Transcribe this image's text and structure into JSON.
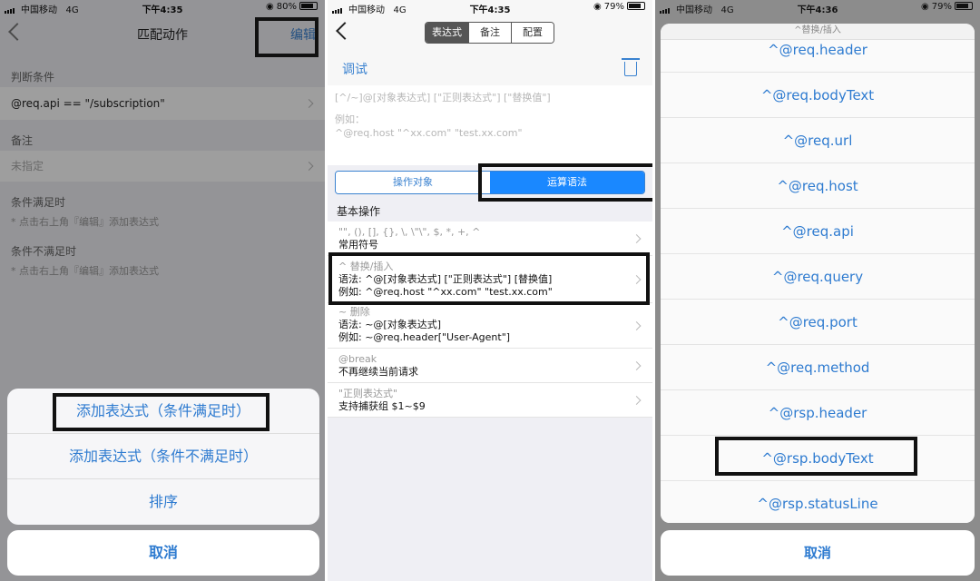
{
  "panel1": {
    "status": {
      "carrier": "中国移动",
      "network": "4G",
      "time": "下午4:35",
      "battery": "80%",
      "battery_level": 0.8
    },
    "nav": {
      "title": "匹配动作",
      "edit": "编辑"
    },
    "sections": [
      {
        "header": "判断条件",
        "value": "@req.api == \"/subscription\""
      },
      {
        "header": "备注",
        "value": "未指定"
      }
    ],
    "condition_met": {
      "header": "条件满足时",
      "hint": "* 点击右上角『编辑』添加表达式"
    },
    "condition_not_met": {
      "header": "条件不满足时",
      "hint": "* 点击右上角『编辑』添加表达式"
    },
    "action_sheet": {
      "options": [
        "添加表达式（条件满足时）",
        "添加表达式（条件不满足时）",
        "排序"
      ],
      "cancel": "取消"
    }
  },
  "panel2": {
    "status": {
      "carrier": "中国移动",
      "network": "4G",
      "time": "下午4:35",
      "battery": "79%",
      "battery_level": 0.79
    },
    "tabs": [
      "表达式",
      "备注",
      "配置"
    ],
    "debug": {
      "label": "调试"
    },
    "input": {
      "placeholder_line1": "[^/~]@[对象表达式] [\"正则表达式\"] [\"替换值\"]",
      "placeholder_line2": "例如：",
      "placeholder_line3": "^@req.host \"^xx.com\" \"test.xx.com\""
    },
    "mode_tabs": [
      "操作对象",
      "运算语法"
    ],
    "section_title": "基本操作",
    "operations": [
      {
        "line1": "\"\", (), [], {}, \\, \\\"\\\", $, *, +, ^",
        "line2": "常用符号"
      },
      {
        "line1": "^ 替换/插入",
        "line2": "语法: ^@[对象表达式] [\"正则表达式\"] [替换值]",
        "line3": "例如: ^@req.host \"^xx.com\" \"test.xx.com\""
      },
      {
        "line1": "~ 删除",
        "line2": "语法: ~@[对象表达式]",
        "line3": "例如: ~@req.header[\"User-Agent\"]"
      },
      {
        "line1": "@break",
        "line2": "不再继续当前请求"
      },
      {
        "line1": "\"正则表达式\"",
        "line2": "支持捕获组 $1~$9"
      }
    ]
  },
  "panel3": {
    "status": {
      "carrier": "中国移动",
      "network": "4G",
      "time": "下午4:36",
      "battery": "79%",
      "battery_level": 0.79
    },
    "sheet_title": "^替换/插入",
    "options": [
      "^@req.header",
      "^@req.bodyText",
      "^@req.url",
      "^@req.host",
      "^@req.api",
      "^@req.query",
      "^@req.port",
      "^@req.method",
      "^@rsp.header",
      "^@rsp.bodyText",
      "^@rsp.statusLine"
    ],
    "cancel": "取消"
  }
}
